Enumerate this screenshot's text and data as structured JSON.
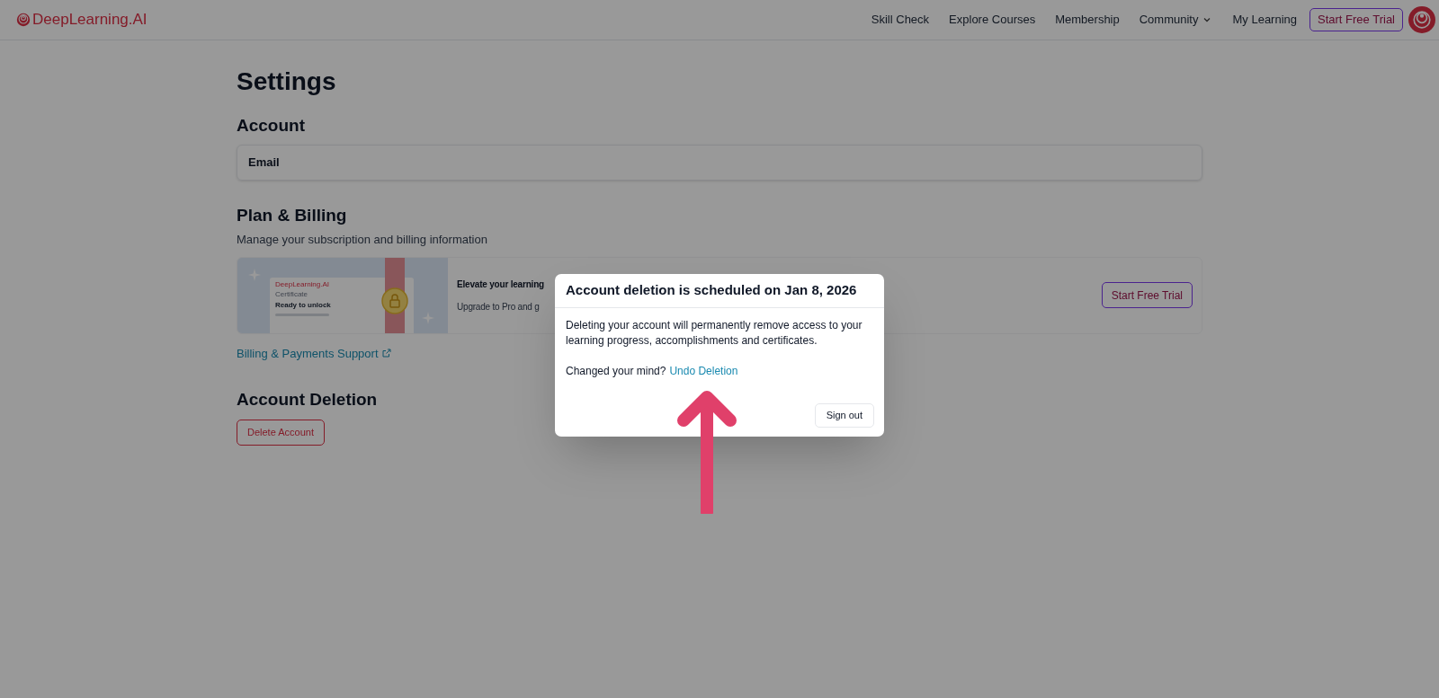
{
  "header": {
    "logo": "DeepLearning.AI",
    "nav": [
      {
        "label": "Skill Check",
        "kind": "link"
      },
      {
        "label": "Explore Courses",
        "kind": "link"
      },
      {
        "label": "Membership",
        "kind": "link"
      },
      {
        "label": "Community",
        "kind": "dropdown"
      },
      {
        "label": "My Learning",
        "kind": "link"
      }
    ],
    "cta": "Start Free Trial"
  },
  "page": {
    "title": "Settings",
    "account": {
      "heading": "Account",
      "email_label": "Email"
    },
    "billing": {
      "heading": "Plan & Billing",
      "subtitle": "Manage your subscription and billing information",
      "promo": {
        "certificate": {
          "brand": "DeepLearning.AI",
          "label": "Certificate",
          "status": "Ready to unlock"
        },
        "title": "Elevate your learning",
        "text": "Upgrade to Pro and g",
        "button": "Start Free Trial"
      },
      "support_link": "Billing & Payments Support"
    },
    "deletion": {
      "heading": "Account Deletion",
      "button": "Delete Account"
    }
  },
  "dialog": {
    "title": "Account deletion is scheduled on Jan 8, 2026",
    "body": "Deleting your account will permanently remove access to your learning progress, accomplishments and certificates.",
    "prompt": "Changed your mind?",
    "link": "Undo Deletion",
    "button": "Sign out"
  }
}
